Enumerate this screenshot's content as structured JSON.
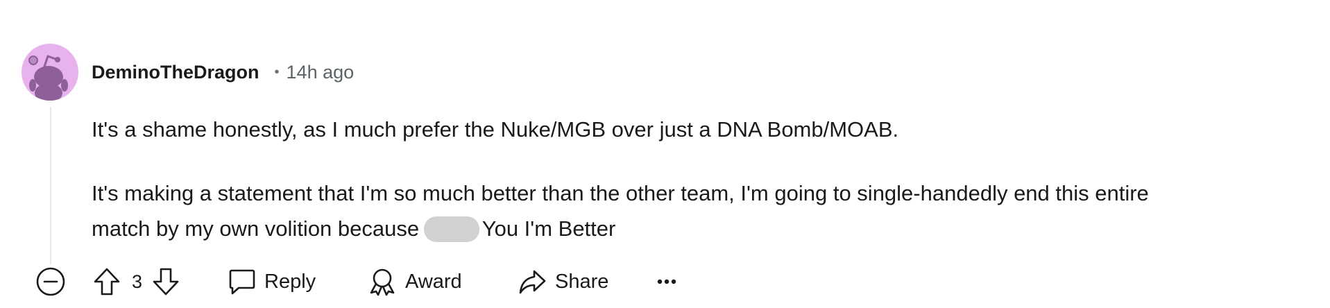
{
  "comment": {
    "author": "DeminoTheDragon",
    "separator": "•",
    "timestamp": "14h ago",
    "paragraph_1": "It's a shame honestly, as I much prefer the Nuke/MGB over just a DNA Bomb/MOAB.",
    "paragraph_2_line_1": "It's making a statement that I'm so much better than the other team, I'm going to single-handedly end this entire",
    "paragraph_2_line_2_before": "match by my own volition because",
    "paragraph_2_line_2_after": "You I'm Better",
    "avatar_color": "#e8b2ee"
  },
  "actions": {
    "collapse_icon": "minus-circle-icon",
    "upvote_icon": "upvote-arrow-icon",
    "vote_count": "3",
    "downvote_icon": "downvote-arrow-icon",
    "reply_label": "Reply",
    "reply_icon": "speech-bubble-icon",
    "award_label": "Award",
    "award_icon": "award-ribbon-icon",
    "share_label": "Share",
    "share_icon": "share-arrow-icon",
    "more_label": "···"
  }
}
